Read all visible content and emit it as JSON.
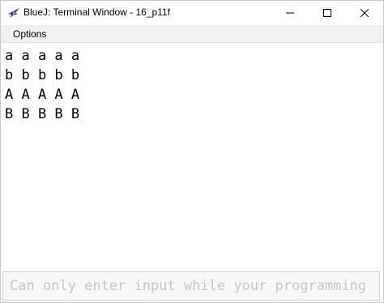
{
  "window": {
    "title": "BlueJ: Terminal Window - 16_p11f",
    "icon": "bluej-bird-icon"
  },
  "controls": {
    "minimize": "minimize-icon",
    "maximize": "maximize-icon",
    "close": "close-icon"
  },
  "menubar": {
    "items": [
      {
        "label": "Options"
      }
    ]
  },
  "terminal": {
    "lines": [
      "a a a a a",
      "b b b b b",
      "A A A A A",
      "B B B B B"
    ]
  },
  "input": {
    "placeholder": "Can only enter input while your programming",
    "value": ""
  }
}
